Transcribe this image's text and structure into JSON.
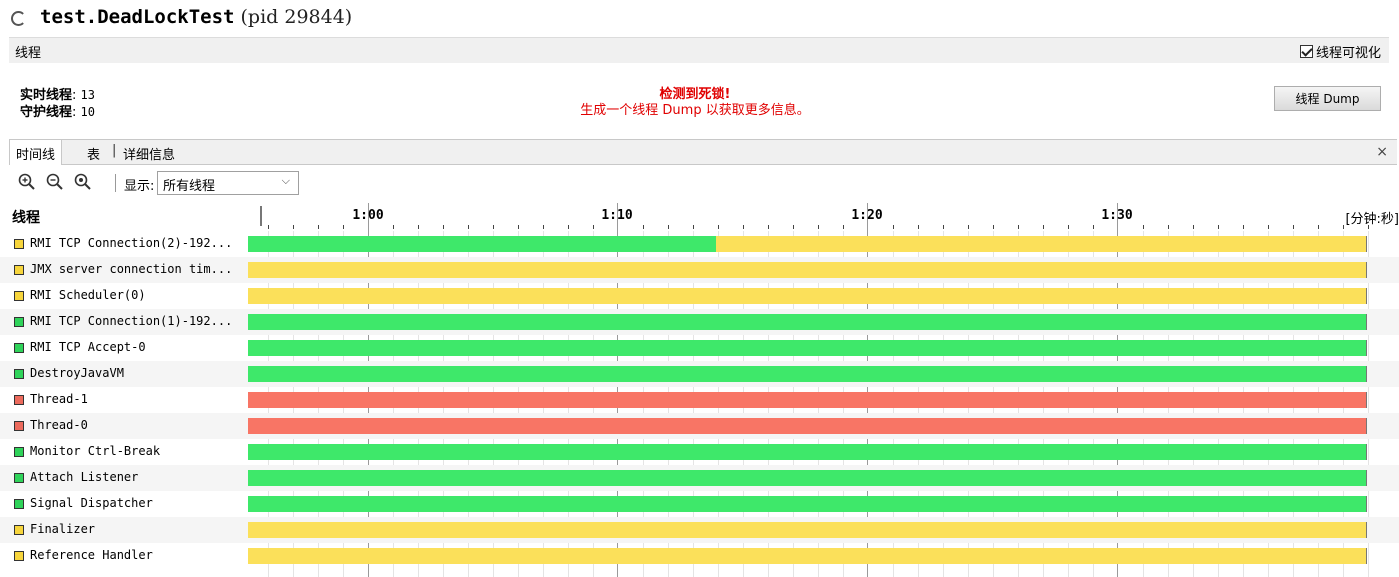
{
  "header": {
    "title_main": "test.DeadLockTest",
    "title_pid": "(pid 29844)",
    "section_title": "线程",
    "viz_toggle_label": "线程可视化",
    "viz_toggle_checked": true
  },
  "info": {
    "live_label": "实时线程",
    "live_value": "13",
    "daemon_label": "守护线程",
    "daemon_value": "10",
    "deadlock_heading": "检测到死锁!",
    "deadlock_message": "生成一个线程 Dump 以获取更多信息。",
    "dump_button": "线程 Dump"
  },
  "tabs": [
    "时间线",
    "表",
    "详细信息"
  ],
  "tab_close": "×",
  "toolbar": {
    "icons": [
      "zoom-in-icon",
      "zoom-out-icon",
      "zoom-fit-icon"
    ],
    "show_label": "显示:",
    "filter_value": "所有线程"
  },
  "timeline": {
    "threads_header": "线程",
    "tick_labels": [
      "1:00",
      "1:10",
      "1:20",
      "1:30"
    ],
    "unit_label": "[分钟:秒]",
    "colors": {
      "running": "#3ee86a",
      "waiting": "#fbe05a",
      "monitor": "#f87565",
      "swatch_running": "#2fd35a",
      "swatch_waiting": "#f7d53c",
      "swatch_monitor": "#ec6a5c"
    }
  },
  "threads": [
    {
      "name": "RMI TCP Connection(2)-192...",
      "swatch": "waiting",
      "segments": [
        {
          "state": "running",
          "fraction": 0.419
        },
        {
          "state": "waiting",
          "fraction": 0.581
        }
      ]
    },
    {
      "name": "JMX server connection tim...",
      "swatch": "waiting",
      "segments": [
        {
          "state": "waiting",
          "fraction": 1
        }
      ]
    },
    {
      "name": "RMI Scheduler(0)",
      "swatch": "waiting",
      "segments": [
        {
          "state": "waiting",
          "fraction": 1
        }
      ]
    },
    {
      "name": "RMI TCP Connection(1)-192...",
      "swatch": "running",
      "segments": [
        {
          "state": "running",
          "fraction": 1
        }
      ]
    },
    {
      "name": "RMI TCP Accept-0",
      "swatch": "running",
      "segments": [
        {
          "state": "running",
          "fraction": 1
        }
      ]
    },
    {
      "name": "DestroyJavaVM",
      "swatch": "running",
      "segments": [
        {
          "state": "running",
          "fraction": 1
        }
      ]
    },
    {
      "name": "Thread-1",
      "swatch": "monitor",
      "segments": [
        {
          "state": "monitor",
          "fraction": 1
        }
      ]
    },
    {
      "name": "Thread-0",
      "swatch": "monitor",
      "segments": [
        {
          "state": "monitor",
          "fraction": 1
        }
      ]
    },
    {
      "name": "Monitor Ctrl-Break",
      "swatch": "running",
      "segments": [
        {
          "state": "running",
          "fraction": 1
        }
      ]
    },
    {
      "name": "Attach Listener",
      "swatch": "running",
      "segments": [
        {
          "state": "running",
          "fraction": 1
        }
      ]
    },
    {
      "name": "Signal Dispatcher",
      "swatch": "running",
      "segments": [
        {
          "state": "running",
          "fraction": 1
        }
      ]
    },
    {
      "name": "Finalizer",
      "swatch": "waiting",
      "segments": [
        {
          "state": "waiting",
          "fraction": 1
        }
      ]
    },
    {
      "name": "Reference Handler",
      "swatch": "waiting",
      "segments": [
        {
          "state": "waiting",
          "fraction": 1
        }
      ]
    }
  ]
}
